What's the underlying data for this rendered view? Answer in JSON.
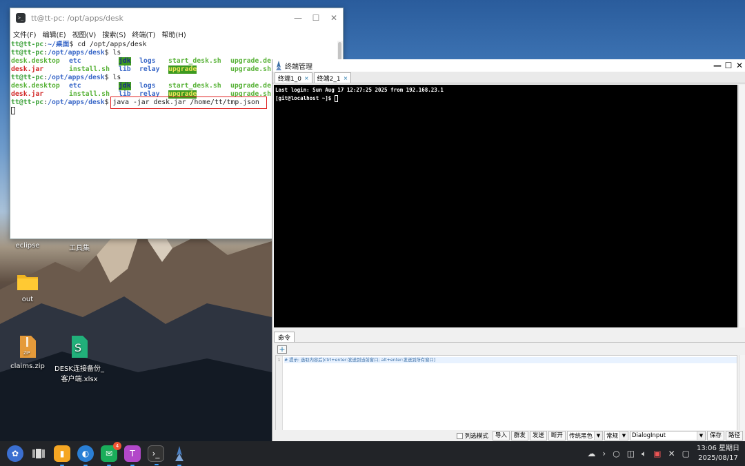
{
  "desktop": {
    "icons": [
      {
        "label": "eclipse"
      },
      {
        "label": "工具集"
      },
      {
        "label": "out"
      },
      {
        "label": "claims.zip"
      },
      {
        "label": "DESK连接备份_客户端.xlsx"
      }
    ],
    "zip_badge": "ZIP"
  },
  "terminal": {
    "title": "tt@tt-pc: /opt/apps/desk",
    "icon_text": ">_",
    "menu": [
      "文件(F)",
      "编辑(E)",
      "视图(V)",
      "搜索(S)",
      "终端(T)",
      "帮助(H)"
    ],
    "lines": {
      "l1_user": "tt@tt-pc",
      "l1_path": "~/桌面",
      "l1_cmd": "$ cd /opt/apps/desk",
      "l2_user": "tt@tt-pc",
      "l2_path": "/opt/apps/desk",
      "l2_cmd": "$ ls",
      "ls_a": [
        "desk.desktop",
        "etc",
        "jdk",
        "logs",
        "start_desk.sh",
        "upgrade.de"
      ],
      "ls_b": [
        "desk.jar",
        "install.sh",
        "lib",
        "relay",
        "upgrade",
        "upgrade.sh"
      ],
      "l5_user": "tt@tt-pc",
      "l5_path": "/opt/apps/desk",
      "l5_cmd": "$ ls",
      "ls_c": [
        "desk.desktop",
        "etc",
        "jdk",
        "logs",
        "start_desk.sh",
        "upgrade.de"
      ],
      "ls_d": [
        "desk.jar",
        "install.sh",
        "lib",
        "relay",
        "upgrade",
        "upgrade.sh"
      ],
      "l8_user": "tt@tt-pc",
      "l8_path": "/opt/apps/desk",
      "l8_prompt": "$",
      "l8_cmd": "java -jar desk.jar /home/tt/tmp.json"
    }
  },
  "terminal_manager": {
    "title": "终端管理",
    "tabs": [
      {
        "label": "终端1_0"
      },
      {
        "label": "终端2_1"
      }
    ],
    "tab_close": "×",
    "screen": {
      "line1": "Last login: Sun Aug 17 12:27:25 2025 from 192.168.23.1",
      "line2": "[git@localhost ~]$ "
    },
    "panel_tab": "命令",
    "add_label": "+",
    "editor": {
      "line_no": "1",
      "text": "# 提示: 选取内容后[ctrl+enter:发送到当前窗口; alt+enter:发送到所有窗口]"
    },
    "bottom": {
      "column_mode": "列选模式",
      "import": "导入",
      "broadcast": "群发",
      "send": "发送",
      "disconnect": "断开",
      "theme": "传统黑色",
      "style": "常规",
      "font": "DialogInput",
      "save": "保存",
      "path": "路径"
    }
  },
  "taskbar": {
    "badge_count": "4",
    "clock_time": "13:06 星期日",
    "clock_date": "2025/08/17"
  }
}
